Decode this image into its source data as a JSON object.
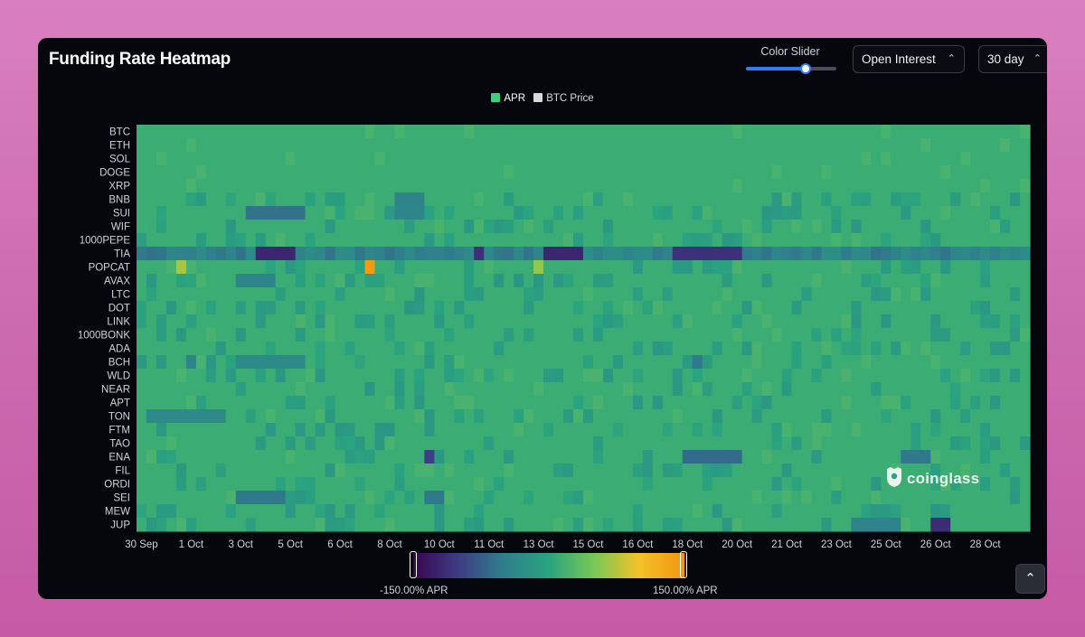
{
  "header": {
    "title": "Funding Rate Heatmap",
    "slider_label": "Color Slider",
    "slider_value": 0.66,
    "oi_select": "Open Interest",
    "period_select": "30 day"
  },
  "legend": {
    "items": [
      {
        "label": "APR",
        "color": "#39d180"
      },
      {
        "label": "BTC Price",
        "color": "#d9d9d9"
      }
    ]
  },
  "colorbar": {
    "min_label": "-150.00% APR",
    "max_label": "150.00% APR",
    "stops": [
      "#38064f",
      "#3d3c84",
      "#2f7f8c",
      "#2aa37f",
      "#77c855",
      "#f5c227",
      "#f29513"
    ]
  },
  "watermark": {
    "text": "coinglass"
  },
  "icons": {
    "scroll_top": "chevron-up-icon",
    "select_chevron": "updown-chevron-icon",
    "brand": "coinglass-logo-icon"
  },
  "chart_data": {
    "type": "heatmap",
    "title": "Funding Rate Heatmap",
    "value_range": [
      -150,
      150
    ],
    "unit": "% APR",
    "base_value": 12,
    "columns": 90,
    "y_categories": [
      "BTC",
      "ETH",
      "SOL",
      "DOGE",
      "XRP",
      "BNB",
      "SUI",
      "WIF",
      "1000PEPE",
      "TIA",
      "POPCAT",
      "AVAX",
      "LTC",
      "DOT",
      "LINK",
      "1000BONK",
      "ADA",
      "BCH",
      "WLD",
      "NEAR",
      "APT",
      "TON",
      "FTM",
      "TAO",
      "ENA",
      "FIL",
      "ORDI",
      "SEI",
      "MEW",
      "JUP"
    ],
    "x_labels": [
      {
        "label": "30 Sep",
        "col": 0
      },
      {
        "label": "1 Oct",
        "col": 5
      },
      {
        "label": "3 Oct",
        "col": 10
      },
      {
        "label": "5 Oct",
        "col": 15
      },
      {
        "label": "6 Oct",
        "col": 20
      },
      {
        "label": "8 Oct",
        "col": 25
      },
      {
        "label": "10 Oct",
        "col": 30
      },
      {
        "label": "11 Oct",
        "col": 35
      },
      {
        "label": "13 Oct",
        "col": 40
      },
      {
        "label": "15 Oct",
        "col": 45
      },
      {
        "label": "16 Oct",
        "col": 50
      },
      {
        "label": "18 Oct",
        "col": 55
      },
      {
        "label": "20 Oct",
        "col": 60
      },
      {
        "label": "21 Oct",
        "col": 65
      },
      {
        "label": "23 Oct",
        "col": 70
      },
      {
        "label": "25 Oct",
        "col": 75
      },
      {
        "label": "26 Oct",
        "col": 80
      },
      {
        "label": "28 Oct",
        "col": 85
      }
    ],
    "notable_cells": [
      {
        "row": "SUI",
        "from": 11,
        "to": 16,
        "value": -60
      },
      {
        "row": "SUI",
        "from": 26,
        "to": 28,
        "value": -40
      },
      {
        "row": "BNB",
        "from": 26,
        "to": 28,
        "value": -45
      },
      {
        "row": "TIA",
        "from": 0,
        "to": 89,
        "value": -45
      },
      {
        "row": "TIA",
        "from": 12,
        "to": 15,
        "value": -120
      },
      {
        "row": "TIA",
        "from": 34,
        "to": 34,
        "value": -110
      },
      {
        "row": "TIA",
        "from": 41,
        "to": 44,
        "value": -120
      },
      {
        "row": "TIA",
        "from": 54,
        "to": 60,
        "value": -110
      },
      {
        "row": "POPCAT",
        "from": 23,
        "to": 23,
        "value": 145
      },
      {
        "row": "POPCAT",
        "from": 4,
        "to": 4,
        "value": 70
      },
      {
        "row": "POPCAT",
        "from": 40,
        "to": 40,
        "value": 60
      },
      {
        "row": "AVAX",
        "from": 10,
        "to": 13,
        "value": -45
      },
      {
        "row": "BCH",
        "from": 5,
        "to": 5,
        "value": -45
      },
      {
        "row": "BCH",
        "from": 10,
        "to": 16,
        "value": -35
      },
      {
        "row": "BCH",
        "from": 56,
        "to": 56,
        "value": -55
      },
      {
        "row": "TON",
        "from": 1,
        "to": 8,
        "value": -35
      },
      {
        "row": "ENA",
        "from": 29,
        "to": 29,
        "value": -100
      },
      {
        "row": "ENA",
        "from": 55,
        "to": 60,
        "value": -65
      },
      {
        "row": "ENA",
        "from": 77,
        "to": 79,
        "value": -55
      },
      {
        "row": "SEI",
        "from": 10,
        "to": 14,
        "value": -55
      },
      {
        "row": "SEI",
        "from": 29,
        "to": 30,
        "value": -55
      },
      {
        "row": "JUP",
        "from": 80,
        "to": 81,
        "value": -115
      },
      {
        "row": "JUP",
        "from": 72,
        "to": 76,
        "value": -45
      }
    ]
  }
}
